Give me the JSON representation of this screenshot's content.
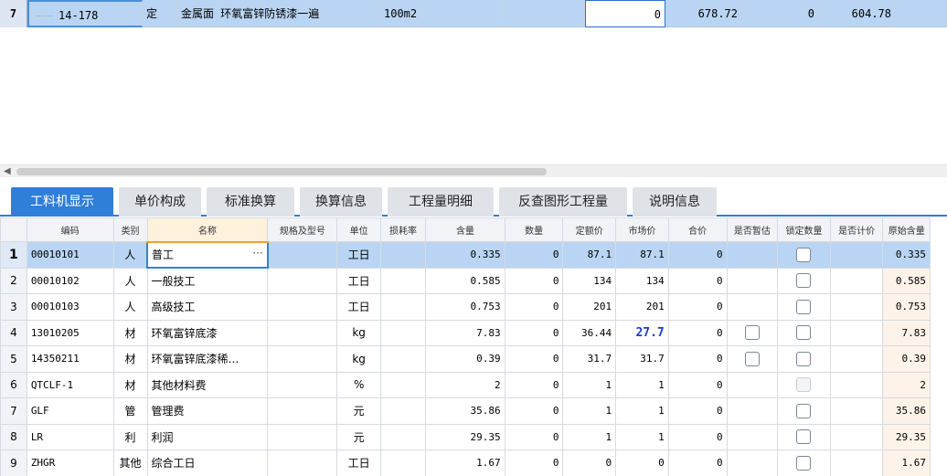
{
  "top_row": {
    "row_number": "7",
    "code": "14-178",
    "type": "定",
    "name": "金属面 环氧富锌防锈漆一遍",
    "unit": "100m2",
    "quantity": "0",
    "price1": "678.72",
    "price2": "0",
    "price3": "604.78"
  },
  "tabs": [
    "工料机显示",
    "单价构成",
    "标准换算",
    "换算信息",
    "工程量明细",
    "反查图形工程量",
    "说明信息"
  ],
  "columns": [
    "编码",
    "类别",
    "名称",
    "规格及型号",
    "单位",
    "损耗率",
    "含量",
    "数量",
    "定额价",
    "市场价",
    "合价",
    "是否暂估",
    "锁定数量",
    "是否计价",
    "原始含量"
  ],
  "rows": [
    {
      "no": "1",
      "code": "00010101",
      "cat": "人",
      "name": "普工",
      "spec": "",
      "unit": "工日",
      "loss": "",
      "content": "0.335",
      "qty": "0",
      "quota": "87.1",
      "market": "87.1",
      "total": "0",
      "orig": "0.335",
      "est_cb": false,
      "lock_cb": true,
      "lock_dis": false
    },
    {
      "no": "2",
      "code": "00010102",
      "cat": "人",
      "name": "一般技工",
      "spec": "",
      "unit": "工日",
      "loss": "",
      "content": "0.585",
      "qty": "0",
      "quota": "134",
      "market": "134",
      "total": "0",
      "orig": "0.585",
      "est_cb": false,
      "lock_cb": true,
      "lock_dis": false
    },
    {
      "no": "3",
      "code": "00010103",
      "cat": "人",
      "name": "高级技工",
      "spec": "",
      "unit": "工日",
      "loss": "",
      "content": "0.753",
      "qty": "0",
      "quota": "201",
      "market": "201",
      "total": "0",
      "orig": "0.753",
      "est_cb": false,
      "lock_cb": true,
      "lock_dis": false
    },
    {
      "no": "4",
      "code": "13010205",
      "cat": "材",
      "name": "环氧富锌底漆",
      "spec": "",
      "unit": "kg",
      "loss": "",
      "content": "7.83",
      "qty": "0",
      "quota": "36.44",
      "market": "27.7",
      "total": "0",
      "orig": "7.83",
      "est_cb": true,
      "lock_cb": true,
      "lock_dis": false
    },
    {
      "no": "5",
      "code": "14350211",
      "cat": "材",
      "name": "环氧富锌底漆稀…",
      "spec": "",
      "unit": "kg",
      "loss": "",
      "content": "0.39",
      "qty": "0",
      "quota": "31.7",
      "market": "31.7",
      "total": "0",
      "orig": "0.39",
      "est_cb": true,
      "lock_cb": true,
      "lock_dis": false
    },
    {
      "no": "6",
      "code": "QTCLF-1",
      "cat": "材",
      "name": "其他材料费",
      "spec": "",
      "unit": "%",
      "loss": "",
      "content": "2",
      "qty": "0",
      "quota": "1",
      "market": "1",
      "total": "0",
      "orig": "2",
      "est_cb": false,
      "lock_cb": true,
      "lock_dis": true
    },
    {
      "no": "7",
      "code": "GLF",
      "cat": "管",
      "name": "管理费",
      "spec": "",
      "unit": "元",
      "loss": "",
      "content": "35.86",
      "qty": "0",
      "quota": "1",
      "market": "1",
      "total": "0",
      "orig": "35.86",
      "est_cb": false,
      "lock_cb": true,
      "lock_dis": false
    },
    {
      "no": "8",
      "code": "LR",
      "cat": "利",
      "name": "利润",
      "spec": "",
      "unit": "元",
      "loss": "",
      "content": "29.35",
      "qty": "0",
      "quota": "1",
      "market": "1",
      "total": "0",
      "orig": "29.35",
      "est_cb": false,
      "lock_cb": true,
      "lock_dis": false
    },
    {
      "no": "9",
      "code": "ZHGR",
      "cat": "其他",
      "name": "综合工日",
      "spec": "",
      "unit": "工日",
      "loss": "",
      "content": "1.67",
      "qty": "0",
      "quota": "0",
      "market": "0",
      "total": "0",
      "orig": "1.67",
      "est_cb": false,
      "lock_cb": true,
      "lock_dis": false
    }
  ],
  "colors": {
    "tab_active": "#2f7ed8",
    "row_selected": "#b9d5f3",
    "market_changed": "#1a3ccf"
  }
}
